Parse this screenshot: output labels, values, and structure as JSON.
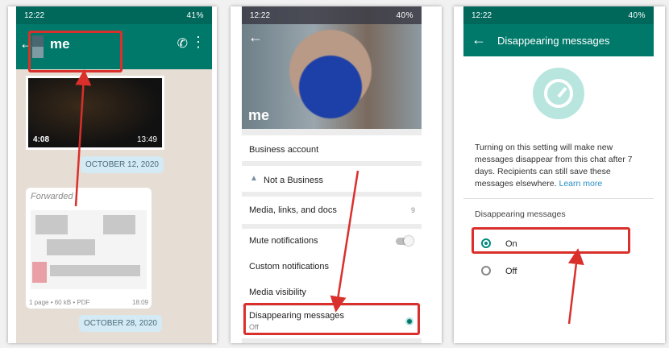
{
  "panel1": {
    "status_time": "12:22",
    "status_right": "41%",
    "contact_name": "me",
    "video_duration": "4:08",
    "video_time": "13:49",
    "date_chip_1": "OCTOBER 12, 2020",
    "forwarded_label": "Forwarded",
    "doc_meta": "1 page • 60 kB • PDF",
    "doc_time": "18:09",
    "date_chip_2": "OCTOBER 28, 2020"
  },
  "panel2": {
    "status_time": "12:22",
    "status_right": "40%",
    "profile_name": "me",
    "rows": {
      "business_account": "Business account",
      "not_business": "Not a Business",
      "media": "Media, links, and docs",
      "media_count": "9",
      "mute": "Mute notifications",
      "custom": "Custom notifications",
      "visibility": "Media visibility",
      "disappearing": "Disappearing messages",
      "disappearing_status": "Off"
    }
  },
  "panel3": {
    "status_time": "12:22",
    "status_right": "40%",
    "title": "Disappearing messages",
    "description": "Turning on this setting will make new messages disappear from this chat after 7 days. Recipients can still save these messages elsewhere.",
    "learn_more": "Learn more",
    "section_label": "Disappearing messages",
    "option_on": "On",
    "option_off": "Off",
    "selected": "On"
  },
  "colors": {
    "accent": "#00796b",
    "highlight": "#d9302c",
    "link": "#2a8ec4"
  }
}
